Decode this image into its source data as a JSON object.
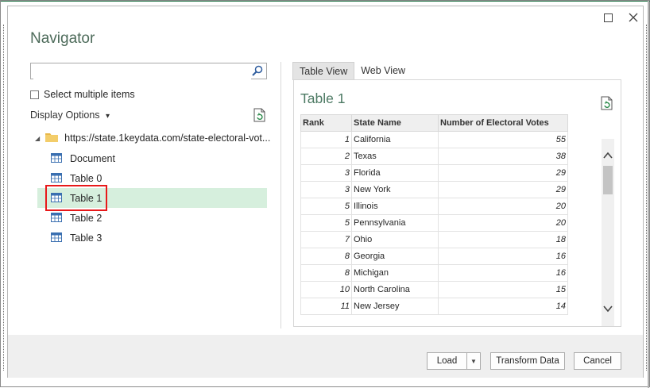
{
  "window": {
    "title": "Navigator"
  },
  "search": {
    "placeholder": "",
    "value": ""
  },
  "select_multiple": {
    "label": "Select multiple items",
    "checked": false
  },
  "display_options": {
    "label": "Display Options",
    "chevron": "▾"
  },
  "tree": {
    "root": {
      "label": "https://state.1keydata.com/state-electoral-vot...",
      "icon": "folder-icon"
    },
    "items": [
      {
        "label": "Document",
        "icon": "table-icon"
      },
      {
        "label": "Table 0",
        "icon": "table-icon"
      },
      {
        "label": "Table 1",
        "icon": "table-icon",
        "selected": true
      },
      {
        "label": "Table 2",
        "icon": "table-icon"
      },
      {
        "label": "Table 3",
        "icon": "table-icon"
      }
    ]
  },
  "preview": {
    "tabs": [
      {
        "label": "Table View",
        "active": true
      },
      {
        "label": "Web View",
        "active": false
      }
    ],
    "title": "Table 1",
    "columns": [
      "Rank",
      "State Name",
      "Number of Electoral Votes"
    ],
    "rows": [
      [
        "1",
        "California",
        "55"
      ],
      [
        "2",
        "Texas",
        "38"
      ],
      [
        "3",
        "Florida",
        "29"
      ],
      [
        "3",
        "New York",
        "29"
      ],
      [
        "5",
        "Illinois",
        "20"
      ],
      [
        "5",
        "Pennsylvania",
        "20"
      ],
      [
        "7",
        "Ohio",
        "18"
      ],
      [
        "8",
        "Georgia",
        "16"
      ],
      [
        "8",
        "Michigan",
        "16"
      ],
      [
        "10",
        "North Carolina",
        "15"
      ],
      [
        "11",
        "New Jersey",
        "14"
      ]
    ]
  },
  "footer": {
    "load": "Load",
    "transform": "Transform Data",
    "cancel": "Cancel"
  },
  "colors": {
    "accent": "#217346",
    "selected": "#d6efdd",
    "highlight_box": "#e8191a",
    "title": "#4d6b5a"
  }
}
